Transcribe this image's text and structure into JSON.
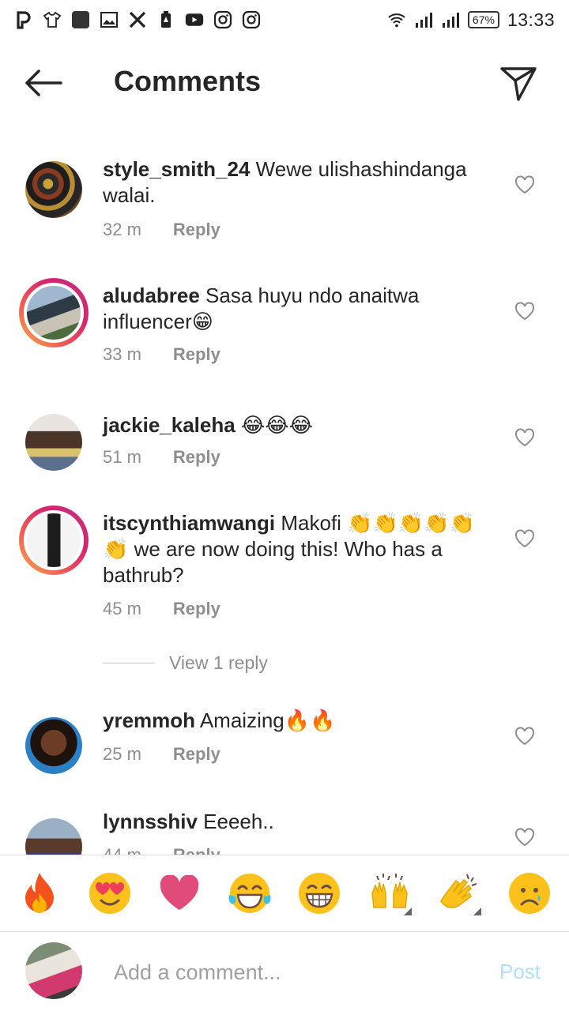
{
  "status_bar": {
    "left_icons": [
      "pinterest-icon",
      "tshirt-icon",
      "square-app-icon",
      "image-icon",
      "x-twitter-icon",
      "battery-saver-icon",
      "youtube-icon",
      "instagram-icon",
      "instagram-icon"
    ],
    "battery": "67%",
    "time": "13:33"
  },
  "header": {
    "title": "Comments",
    "back_icon": "arrow-left-icon",
    "send_icon": "paper-plane-icon"
  },
  "comments": [
    {
      "username": "style_smith_24",
      "text": " Wewe ulishashindanga walai.",
      "time": "32 m",
      "reply_label": "Reply",
      "has_story_ring": false
    },
    {
      "username": "aludabree",
      "text": " Sasa huyu ndo anaitwa influencer😁",
      "time": "33 m",
      "reply_label": "Reply",
      "has_story_ring": true
    },
    {
      "username": "jackie_kaleha",
      "text": " 😂😂😂",
      "time": "51 m",
      "reply_label": "Reply",
      "has_story_ring": false
    },
    {
      "username": "itscynthiamwangi",
      "text": " Makofi 👏👏👏👏👏👏 we are now doing this! Who has a bathrub?",
      "time": "45 m",
      "reply_label": "Reply",
      "has_story_ring": true,
      "view_replies": "View 1 reply"
    },
    {
      "username": "yremmoh",
      "text": " Amaizing🔥🔥",
      "time": "25 m",
      "reply_label": "Reply",
      "has_story_ring": false
    },
    {
      "username": "lynnsshiv",
      "text": " Eeeeh..",
      "time": "44 m",
      "reply_label": "Reply",
      "has_story_ring": false
    }
  ],
  "emoji_bar": [
    "🔥",
    "😍",
    "❤",
    "😂",
    "😁",
    "🙌",
    "👏",
    "😢"
  ],
  "composer": {
    "placeholder": "Add a comment...",
    "post_label": "Post",
    "post_color": "#b2dffc"
  },
  "colors": {
    "text": "#262626",
    "secondary": "#8e8e8e",
    "story_ring_start": "#f7b24b",
    "story_ring_end": "#c13584"
  }
}
